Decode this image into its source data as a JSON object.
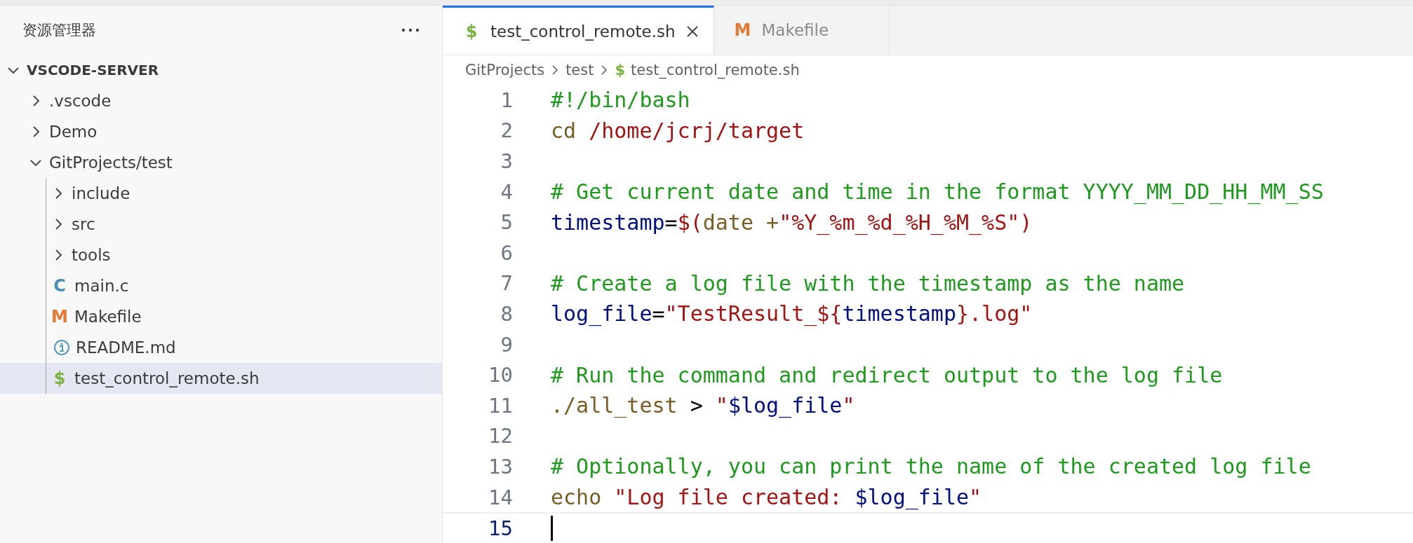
{
  "sidebar": {
    "title": "资源管理器",
    "tree": {
      "label": "VSCODE-SERVER",
      "expanded": true,
      "children": [
        {
          "label": ".vscode",
          "kind": "folder",
          "expanded": false,
          "selected": false
        },
        {
          "label": "Demo",
          "kind": "folder",
          "expanded": false,
          "selected": false
        },
        {
          "label": "GitProjects/test",
          "kind": "folder",
          "expanded": true,
          "selected": false,
          "children": [
            {
              "label": "include",
              "kind": "folder",
              "expanded": false,
              "selected": false
            },
            {
              "label": "src",
              "kind": "folder",
              "expanded": false,
              "selected": false
            },
            {
              "label": "tools",
              "kind": "folder",
              "expanded": false,
              "selected": false
            },
            {
              "label": "main.c",
              "kind": "c",
              "glyph": "C",
              "selected": false
            },
            {
              "label": "Makefile",
              "kind": "makefile",
              "glyph": "M",
              "selected": false
            },
            {
              "label": "README.md",
              "kind": "info",
              "selected": false
            },
            {
              "label": "test_control_remote.sh",
              "kind": "shell",
              "glyph": "$",
              "selected": true
            }
          ]
        }
      ]
    }
  },
  "tabs": [
    {
      "label": "test_control_remote.sh",
      "kind": "shell",
      "glyph": "$",
      "selected": true
    },
    {
      "label": "Makefile",
      "kind": "makefile",
      "glyph": "M",
      "selected": false
    }
  ],
  "breadcrumb": [
    {
      "label": "GitProjects"
    },
    {
      "label": "test"
    },
    {
      "label": "test_control_remote.sh",
      "kind": "shell",
      "glyph": "$"
    }
  ],
  "editor": {
    "lines": [
      {
        "number": "1",
        "current": false,
        "tokens": [
          {
            "kind": "comment",
            "text": "#!/bin/bash"
          }
        ]
      },
      {
        "number": "2",
        "current": false,
        "tokens": [
          {
            "kind": "command",
            "text": "cd "
          },
          {
            "kind": "string",
            "text": "/home/jcrj/target"
          }
        ]
      },
      {
        "number": "3",
        "current": false
      },
      {
        "number": "4",
        "current": false,
        "tokens": [
          {
            "kind": "comment",
            "text": "# Get current date and time in the format YYYY_MM_DD_HH_MM_SS"
          }
        ]
      },
      {
        "number": "5",
        "current": false,
        "tokens": [
          {
            "kind": "variable",
            "text": "timestamp"
          },
          {
            "kind": "plain",
            "text": "="
          },
          {
            "kind": "string",
            "text": "$("
          },
          {
            "kind": "command",
            "text": "date +"
          },
          {
            "kind": "string",
            "text": "\"%Y_%m_%d_%H_%M_%S\")"
          }
        ]
      },
      {
        "number": "6",
        "current": false
      },
      {
        "number": "7",
        "current": false,
        "tokens": [
          {
            "kind": "comment",
            "text": "# Create a log file with the timestamp as the name"
          }
        ]
      },
      {
        "number": "8",
        "current": false,
        "tokens": [
          {
            "kind": "variable",
            "text": "log_file"
          },
          {
            "kind": "plain",
            "text": "="
          },
          {
            "kind": "string",
            "text": "\"TestResult_${"
          },
          {
            "kind": "variable",
            "text": "timestamp"
          },
          {
            "kind": "string",
            "text": "}.log\""
          }
        ]
      },
      {
        "number": "9",
        "current": false
      },
      {
        "number": "10",
        "current": false,
        "tokens": [
          {
            "kind": "comment",
            "text": "# Run the command and redirect output to the log file"
          }
        ]
      },
      {
        "number": "11",
        "current": false,
        "tokens": [
          {
            "kind": "command",
            "text": "./all_test"
          },
          {
            "kind": "plain",
            "text": " > "
          },
          {
            "kind": "string",
            "text": "\""
          },
          {
            "kind": "variable",
            "text": "$log_file"
          },
          {
            "kind": "string",
            "text": "\""
          }
        ]
      },
      {
        "number": "12",
        "current": false
      },
      {
        "number": "13",
        "current": false,
        "tokens": [
          {
            "kind": "comment",
            "text": "# Optionally, you can print the name of the created log file"
          }
        ]
      },
      {
        "number": "14",
        "current": false,
        "tokens": [
          {
            "kind": "command",
            "text": "echo "
          },
          {
            "kind": "string",
            "text": "\"Log file created: "
          },
          {
            "kind": "variable",
            "text": "$log_file"
          },
          {
            "kind": "string",
            "text": "\""
          }
        ]
      },
      {
        "number": "15",
        "current": true
      }
    ]
  }
}
